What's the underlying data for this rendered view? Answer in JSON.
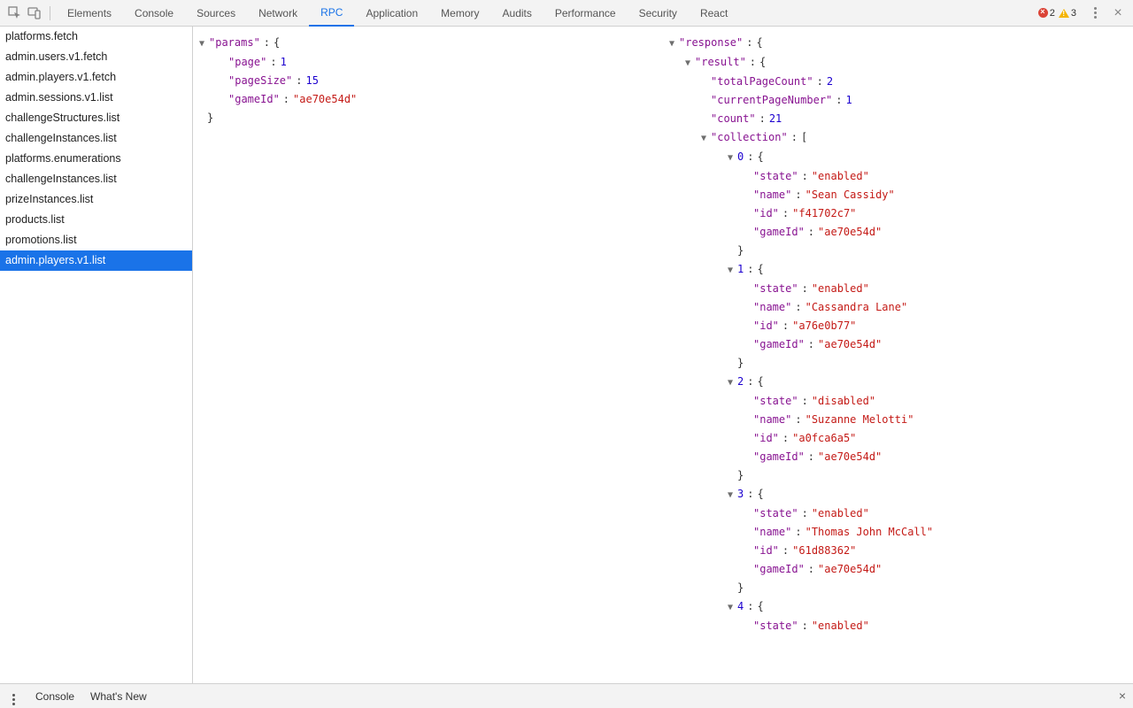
{
  "toolbar": {
    "tabs": [
      "Elements",
      "Console",
      "Sources",
      "Network",
      "RPC",
      "Application",
      "Memory",
      "Audits",
      "Performance",
      "Security",
      "React"
    ],
    "active_tab": "RPC",
    "error_count": "2",
    "warn_count": "3"
  },
  "sidebar": {
    "items": [
      "platforms.fetch",
      "admin.users.v1.fetch",
      "admin.players.v1.fetch",
      "admin.sessions.v1.list",
      "challengeStructures.list",
      "challengeInstances.list",
      "platforms.enumerations",
      "challengeInstances.list",
      "prizeInstances.list",
      "products.list",
      "promotions.list",
      "admin.players.v1.list"
    ],
    "selected_index": 11
  },
  "params": {
    "label": "\"params\"",
    "open": "{",
    "page_key": "\"page\"",
    "page_val": "1",
    "pageSize_key": "\"pageSize\"",
    "pageSize_val": "15",
    "gameId_key": "\"gameId\"",
    "gameId_val": "\"ae70e54d\"",
    "close": "}"
  },
  "response": {
    "label": "\"response\"",
    "result_label": "\"result\"",
    "totalPageCount_key": "\"totalPageCount\"",
    "totalPageCount_val": "2",
    "currentPageNumber_key": "\"currentPageNumber\"",
    "currentPageNumber_val": "1",
    "count_key": "\"count\"",
    "count_val": "21",
    "collection_label": "\"collection\"",
    "bracket_open": "[",
    "brace_open": "{",
    "brace_close": "}",
    "items": [
      {
        "idx": "0",
        "state": "\"enabled\"",
        "name": "\"Sean Cassidy\"",
        "id": "\"f41702c7\"",
        "gameId": "\"ae70e54d\""
      },
      {
        "idx": "1",
        "state": "\"enabled\"",
        "name": "\"Cassandra Lane\"",
        "id": "\"a76e0b77\"",
        "gameId": "\"ae70e54d\""
      },
      {
        "idx": "2",
        "state": "\"disabled\"",
        "name": "\"Suzanne Melotti\"",
        "id": "\"a0fca6a5\"",
        "gameId": "\"ae70e54d\""
      },
      {
        "idx": "3",
        "state": "\"enabled\"",
        "name": "\"Thomas John McCall\"",
        "id": "\"61d88362\"",
        "gameId": "\"ae70e54d\""
      },
      {
        "idx": "4",
        "state": "\"enabled\""
      }
    ],
    "field_keys": {
      "state": "\"state\"",
      "name": "\"name\"",
      "id": "\"id\"",
      "gameId": "\"gameId\""
    }
  },
  "drawer": {
    "console": "Console",
    "whatsnew": "What's New"
  }
}
